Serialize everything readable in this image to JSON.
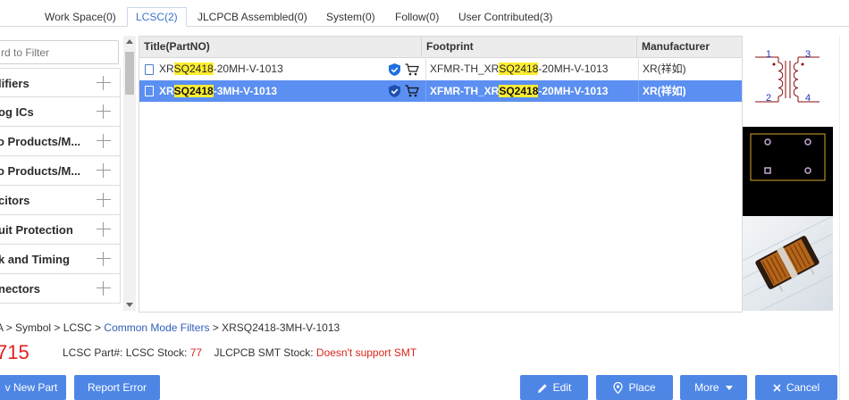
{
  "tabs": [
    {
      "label": "Work Space(0)"
    },
    {
      "label": "LCSC(2)"
    },
    {
      "label": "JLCPCB Assembled(0)"
    },
    {
      "label": "System(0)"
    },
    {
      "label": "Follow(0)"
    },
    {
      "label": "User Contributed(3)"
    }
  ],
  "filter": {
    "placeholder": "rd to Filter"
  },
  "categories": [
    {
      "label": "lifiers"
    },
    {
      "label": "og ICs"
    },
    {
      "label": "o Products/M..."
    },
    {
      "label": "o Products/M..."
    },
    {
      "label": "citors"
    },
    {
      "label": "uit Protection"
    },
    {
      "label": "k and Timing"
    },
    {
      "label": "nectors"
    }
  ],
  "table": {
    "headers": {
      "title": "Title(PartNO)",
      "footprint": "Footprint",
      "manufacturer": "Manufacturer"
    },
    "rows": [
      {
        "title_pre": "XR",
        "title_hl": "SQ2418",
        "title_post": "-20MH-V-1013",
        "fp_pre": "XFMR-TH_XR",
        "fp_hl": "SQ2418",
        "fp_post": "-20MH-V-1013",
        "manufacturer": "XR(祥如)",
        "selected": false
      },
      {
        "title_pre": "XR",
        "title_hl": "SQ2418",
        "title_post": "-3MH-V-1013",
        "fp_pre": "XFMR-TH_XR",
        "fp_hl": "SQ2418",
        "fp_post": "-20MH-V-1013",
        "manufacturer": "XR(祥如)",
        "selected": true
      }
    ]
  },
  "symbol_preview": {
    "pins": [
      "1",
      "2",
      "3",
      "4"
    ]
  },
  "breadcrumb": {
    "pre": "A > Symbol > LCSC > ",
    "link": "Common Mode Filters",
    "post": " > XRSQ2418-3MH-V-1013"
  },
  "price": "715",
  "info": {
    "part_label": "LCSC Part#: LCSC Stock:",
    "stock": "77",
    "smt_label": "JLCPCB SMT Stock:",
    "smt_value": "Doesn't support SMT"
  },
  "buttons": {
    "new_part": "v New Part",
    "report_error": "Report Error",
    "edit": "Edit",
    "place": "Place",
    "more": "More",
    "cancel": "Cancel"
  },
  "colors": {
    "accent": "#4e86e6",
    "selected_row": "#5b8ff2",
    "highlight": "#ffee33",
    "stock_red": "#d9261c"
  },
  "icons": [
    "chip-icon",
    "verified-shield-icon",
    "cart-icon",
    "pencil-icon",
    "location-pin-icon",
    "chevron-down-icon",
    "close-icon"
  ]
}
